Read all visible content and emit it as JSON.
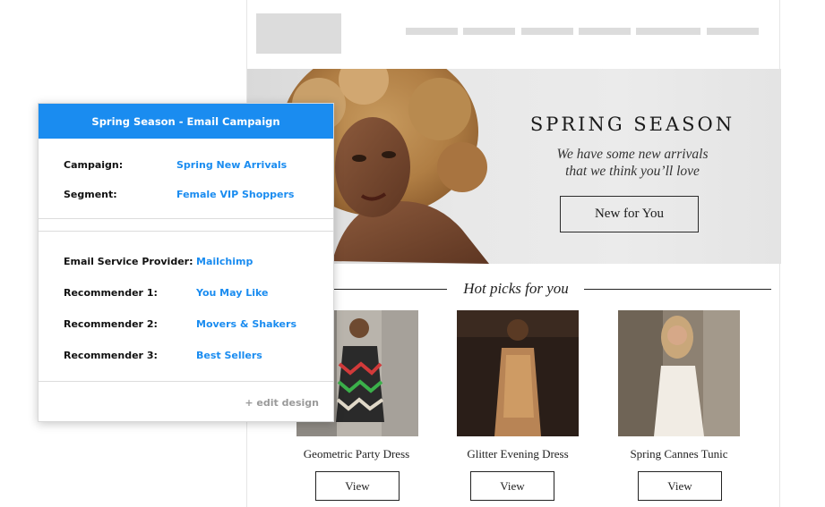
{
  "email": {
    "hero": {
      "title": "SPRING SEASON",
      "subtitle_line1": "We have some new arrivals",
      "subtitle_line2": "that we think you’ll love",
      "button": "New for You"
    },
    "picks_title": "Hot picks for you",
    "products": [
      {
        "name": "Geometric Party Dress",
        "button": "View"
      },
      {
        "name": "Glitter Evening Dress",
        "button": "View"
      },
      {
        "name": "Spring Cannes Tunic",
        "button": "View"
      }
    ]
  },
  "panel": {
    "header": "Spring Season - Email Campaign",
    "campaign_label": "Campaign:",
    "campaign_value": "Spring New Arrivals",
    "segment_label": "Segment:",
    "segment_value": "Female VIP Shoppers",
    "esp_label": "Email Service Provider:",
    "esp_value": "Mailchimp",
    "rec1_label": "Recommender 1:",
    "rec1_value": "You May Like",
    "rec2_label": "Recommender 2:",
    "rec2_value": "Movers & Shakers",
    "rec3_label": "Recommender 3:",
    "rec3_value": "Best Sellers",
    "edit_link": "+ edit design"
  },
  "colors": {
    "accent": "#1a8cf0",
    "placeholder": "#dcdcdc"
  }
}
